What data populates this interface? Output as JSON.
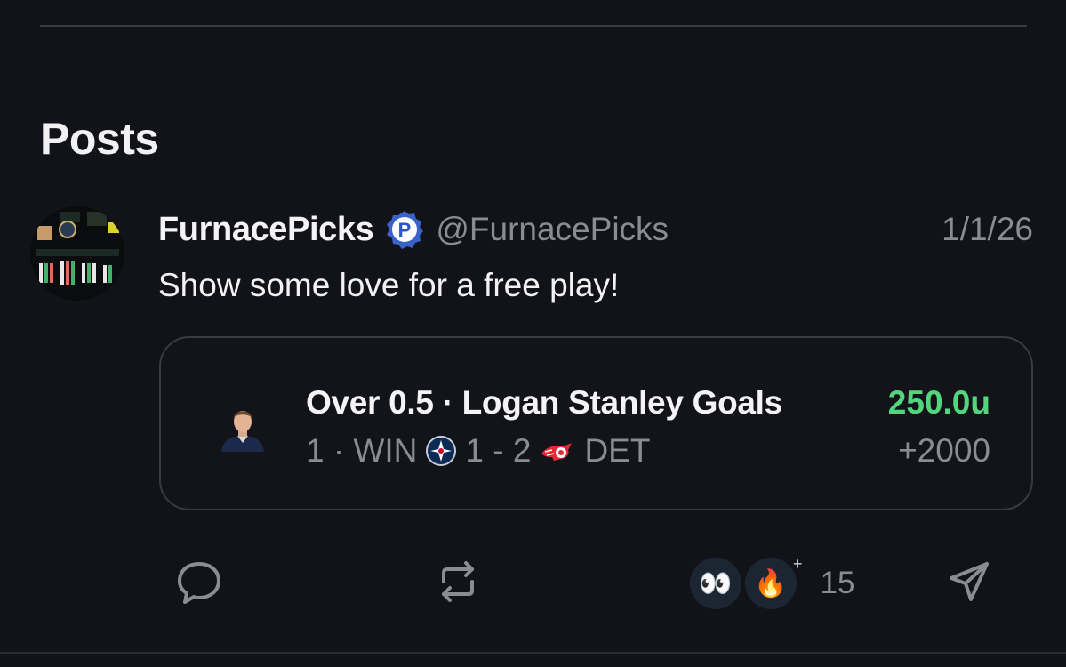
{
  "section": {
    "title": "Posts"
  },
  "post": {
    "author_name": "FurnacePicks",
    "verified_badge_letter": "P",
    "handle": "@FurnacePicks",
    "date": "1/1/26",
    "text": "Show some love for a free play!",
    "pick": {
      "title": "Over 0.5 · Logan Stanley Goals",
      "result_prefix": "1 · WIN",
      "score": "1 - 2",
      "opponent": "DET",
      "units": "250.0u",
      "odds": "+2000",
      "units_color": "#54d47c"
    },
    "actions": {
      "comment_icon": "comment-bubble-icon",
      "repost_icon": "repost-icon",
      "share_icon": "send-icon",
      "reactions": [
        {
          "emoji": "👀",
          "name": "eyes"
        },
        {
          "emoji": "🔥",
          "name": "fire"
        }
      ],
      "reaction_add": "+",
      "reaction_count": "15"
    }
  }
}
